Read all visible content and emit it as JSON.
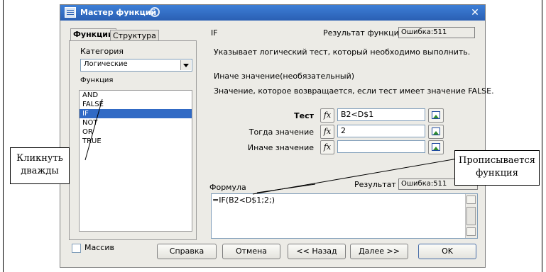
{
  "window": {
    "title": "Мастер функций",
    "close_glyph": "✕"
  },
  "tabs": [
    {
      "label": "Функции"
    },
    {
      "label": "Структура"
    }
  ],
  "left": {
    "category_label": "Категория",
    "category_value": "Логические",
    "function_label": "Функция",
    "functions": [
      "AND",
      "FALSE",
      "IF",
      "NOT",
      "OR",
      "TRUE"
    ],
    "selected_function": "IF",
    "array_label": "Массив"
  },
  "right": {
    "function_name": "IF",
    "result_label": "Результат функции",
    "result_value": "Ошибка:511",
    "description": "Указывает логический тест, который необходимо выполнить.",
    "arg_title": "Иначе значение(необязательный)",
    "arg_description": "Значение, которое возвращается, если тест имеет значение FALSE.",
    "args": [
      {
        "label": "Тест",
        "value": "B2<D$1"
      },
      {
        "label": "Тогда значение",
        "value": "2"
      },
      {
        "label": "Иначе значение",
        "value": ""
      }
    ],
    "fx_glyph": "fx",
    "formula_label": "Формула",
    "formula_result_label": "Результат",
    "formula_result_value": "Ошибка:511",
    "formula_text": "=IF(B2<D$1;2;)"
  },
  "buttons": {
    "help": "Справка",
    "cancel": "Отмена",
    "back": "<< Назад",
    "next": "Далее >>",
    "ok": "OK"
  },
  "annotations": {
    "double_click_line1": "Кликнуть",
    "double_click_line2": "дважды",
    "formula_line1": "Прописывается",
    "formula_line2": "функция"
  },
  "colors": {
    "titlebar": "#2a5fb3",
    "selection": "#316ac5",
    "dialog_bg": "#ecebe6"
  }
}
